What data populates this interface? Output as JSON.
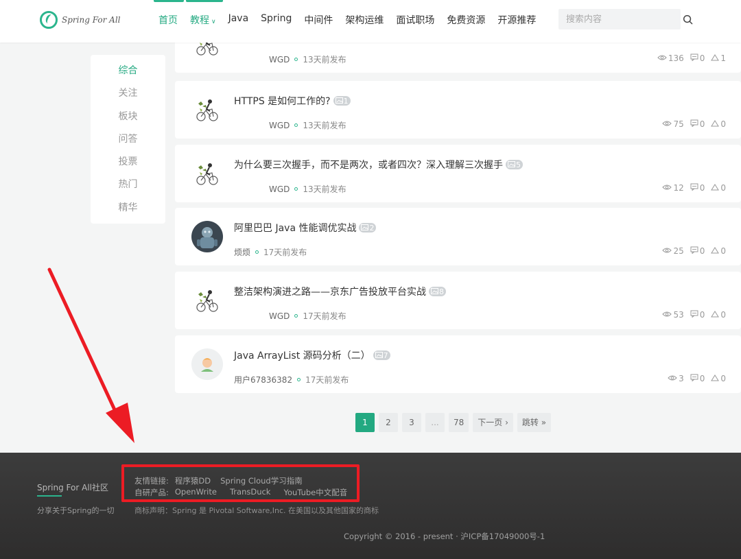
{
  "header": {
    "logo_text": "Spring For All",
    "nav": [
      {
        "label": "首页",
        "active": true
      },
      {
        "label": "教程",
        "active": true,
        "dropdown": true
      },
      {
        "label": "Java"
      },
      {
        "label": "Spring"
      },
      {
        "label": "中间件"
      },
      {
        "label": "架构运维"
      },
      {
        "label": "面试职场"
      },
      {
        "label": "免费资源"
      },
      {
        "label": "开源推荐"
      }
    ],
    "search_placeholder": "搜索内容"
  },
  "sidebar": {
    "items": [
      "综合",
      "关注",
      "板块",
      "问答",
      "投票",
      "热门",
      "精华"
    ]
  },
  "posts": [
    {
      "title": "",
      "image_count": "",
      "author": "WGD",
      "time": "13天前发布",
      "views": "136",
      "comments": "0",
      "likes": "1",
      "avatar": "cyclist"
    },
    {
      "title": "HTTPS 是如何工作的?",
      "image_count": "1",
      "author": "WGD",
      "time": "13天前发布",
      "views": "75",
      "comments": "0",
      "likes": "0",
      "avatar": "cyclist"
    },
    {
      "title": "为什么要三次握手，而不是两次，或者四次？深入理解三次握手",
      "image_count": "5",
      "author": "WGD",
      "time": "13天前发布",
      "views": "12",
      "comments": "0",
      "likes": "0",
      "avatar": "cyclist"
    },
    {
      "title": "阿里巴巴 Java 性能调优实战",
      "image_count": "2",
      "author": "烦烦",
      "time": "17天前发布",
      "views": "25",
      "comments": "0",
      "likes": "0",
      "avatar": "robot"
    },
    {
      "title": "整洁架构演进之路——京东广告投放平台实战",
      "image_count": "8",
      "author": "WGD",
      "time": "17天前发布",
      "views": "53",
      "comments": "0",
      "likes": "0",
      "avatar": "cyclist"
    },
    {
      "title": "Java ArrayList 源码分析（二）",
      "image_count": "7",
      "author": "用户67836382",
      "time": "17天前发布",
      "views": "3",
      "comments": "0",
      "likes": "0",
      "avatar": "default"
    }
  ],
  "pagination": {
    "pages": [
      "1",
      "2",
      "3",
      "...",
      "78"
    ],
    "next_label": "下一页 ›",
    "jump_label": "跳转 »"
  },
  "footer": {
    "brand": "Spring For All社区",
    "tagline": "分享关于Spring的一切",
    "friend_links_label": "友情链接:",
    "friend_links": [
      "程序猿DD",
      "Spring Cloud学习指南"
    ],
    "products_label": "自研产品:",
    "products": [
      "OpenWrite",
      "TransDuck",
      "YouTube中文配音"
    ],
    "trademark": "商标声明：Spring 是 Pivotal Software,Inc. 在美国以及其他国家的商标",
    "copyright": "Copyright © 2016 - present · 沪ICP备17049000号-1"
  },
  "colors": {
    "accent": "#23a981",
    "annotation": "#ec1c24"
  }
}
